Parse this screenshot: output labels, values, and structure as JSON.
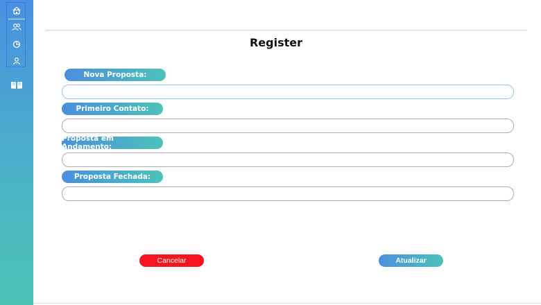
{
  "page": {
    "title": "Register"
  },
  "sidebar": {
    "items": [
      {
        "icon": "home-icon",
        "active": true
      },
      {
        "icon": "users-icon"
      },
      {
        "icon": "pie-chart-icon"
      },
      {
        "icon": "user-icon"
      },
      {
        "icon": "book-icon"
      }
    ]
  },
  "form": {
    "fields": [
      {
        "label": "Nova Proposta:",
        "value": ""
      },
      {
        "label": "Primeiro Contato:",
        "value": ""
      },
      {
        "label": "Proposta em Andamento:",
        "value": ""
      },
      {
        "label": "Proposta Fechada:",
        "value": ""
      }
    ]
  },
  "actions": {
    "cancel_label": "Cancelar",
    "update_label": "Atualizar"
  },
  "colors": {
    "sidebar_top": "#4a8fe0",
    "sidebar_bottom": "#4cc3b6",
    "cancel": "#f5141f",
    "accent_gradient_start": "#4a8fdc",
    "accent_gradient_end": "#4cc2b9"
  }
}
